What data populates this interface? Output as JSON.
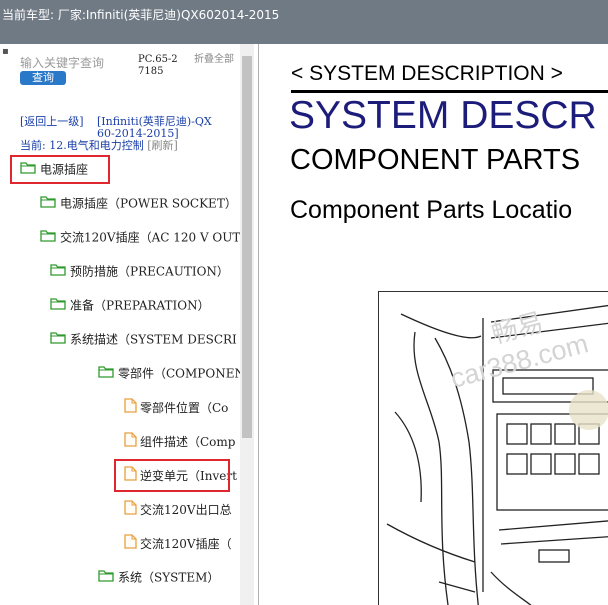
{
  "window": {
    "title": "当前车型:  厂家:Infiniti(英菲尼迪)QX602014-2015"
  },
  "sidebar": {
    "search": {
      "placeholder": "输入关键字查询",
      "button_label": "查询"
    },
    "pc_code": "PC.65-27185",
    "collapse_all_label": "折叠全部",
    "back_link": "[返回上一级]",
    "model_link": "[Infiniti(英菲尼迪)-QX60-2014-2015]",
    "current_label": "当前:",
    "current_value": "12.电气和电力控制",
    "refresh_label": "[刷新]",
    "tree": [
      {
        "label": "电源插座",
        "icon": "folder-icon",
        "highlighted": true
      },
      {
        "label": "电源插座（POWER SOCKET）",
        "icon": "folder-icon"
      },
      {
        "label": "交流120V插座（AC 120 V OUT",
        "icon": "folder-icon"
      },
      {
        "label": "预防措施（PRECAUTION）",
        "icon": "folder-icon"
      },
      {
        "label": "准备（PREPARATION）",
        "icon": "folder-icon"
      },
      {
        "label": "系统描述（SYSTEM DESCRI",
        "icon": "folder-icon"
      },
      {
        "label": "零部件（COMPONEN",
        "icon": "folder-icon"
      },
      {
        "label": "零部件位置（Co",
        "icon": "document-icon"
      },
      {
        "label": "组件描述（Comp",
        "icon": "document-icon"
      },
      {
        "label": "逆变单元（Invert",
        "icon": "document-icon",
        "highlighted": true
      },
      {
        "label": "交流120V出口总",
        "icon": "document-icon"
      },
      {
        "label": "交流120V插座（",
        "icon": "document-icon"
      },
      {
        "label": "系统（SYSTEM）",
        "icon": "folder-icon"
      }
    ]
  },
  "document": {
    "header": "< SYSTEM DESCRIPTION >",
    "section_title": "SYSTEM DESCR",
    "subtitle": "COMPONENT PARTS",
    "heading": "Component Parts Locatio",
    "watermark_1": "畅易",
    "watermark_2": "car388.com"
  },
  "colors": {
    "titlebar": "#707a84",
    "highlight": "#e0262e",
    "link": "#1a3fa8",
    "folder": "#2e9a2e",
    "doc_title": "#1c1c7a"
  }
}
